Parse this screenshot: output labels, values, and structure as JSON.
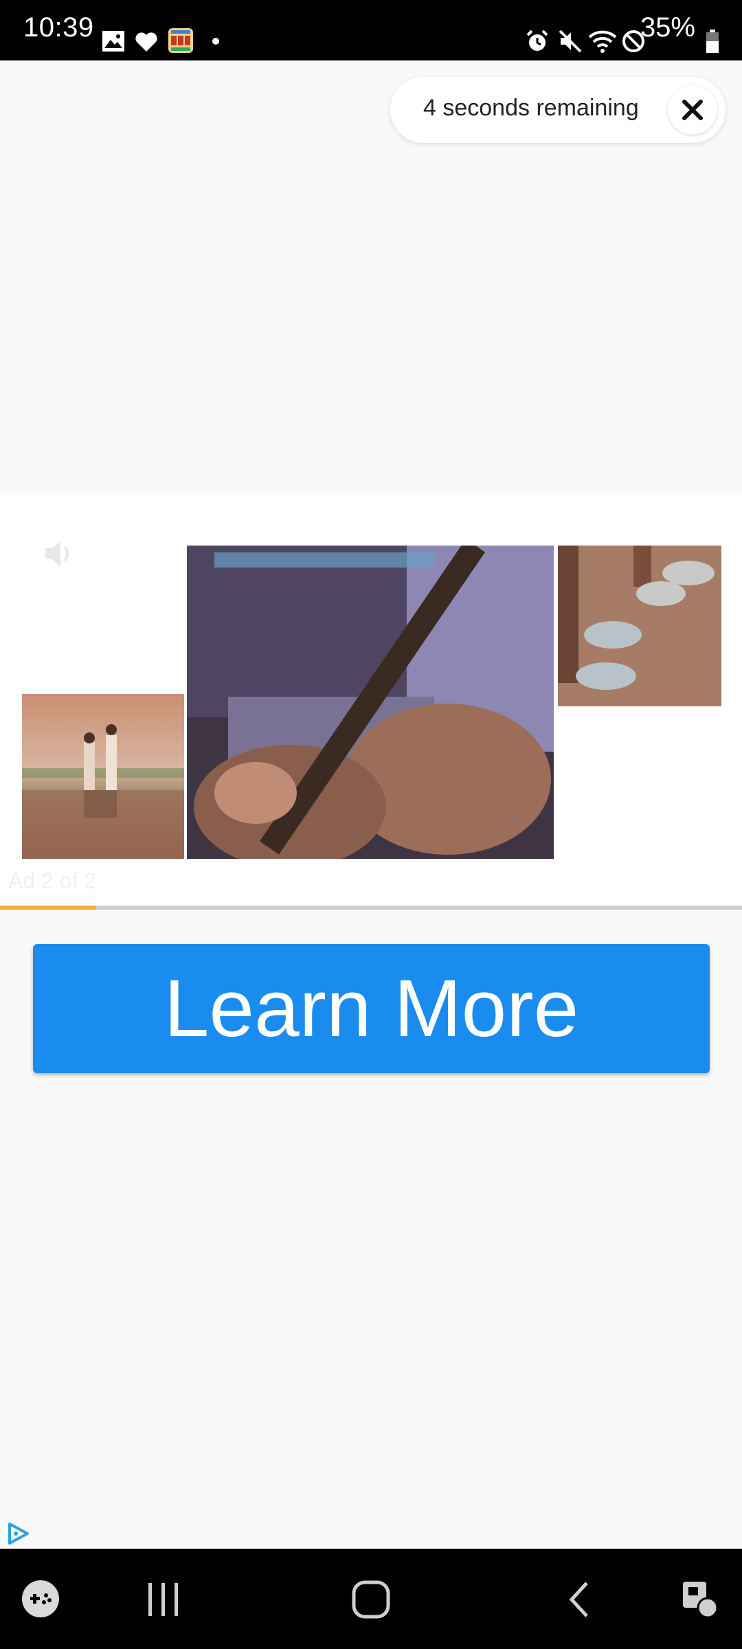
{
  "status_bar": {
    "time": "10:39",
    "battery": "35%",
    "left_icons": [
      "gallery-icon",
      "heart-icon",
      "slots-app-icon",
      "dot-icon"
    ],
    "right_icons": [
      "alarm-icon",
      "mute-icon",
      "wifi-icon",
      "do-not-disturb-icon",
      "battery-icon"
    ]
  },
  "countdown": {
    "text": "4 seconds remaining",
    "close_icon": "close-icon"
  },
  "ad": {
    "counter_text": "Ad 2 of 2",
    "progress": 0.13,
    "progress_color": "#f2b233",
    "sound_icon": "speaker-icon",
    "images": [
      "couple-standing-photo",
      "person-holding-paddle-photo",
      "feet-in-sandals-photo"
    ]
  },
  "cta": {
    "label": "Learn More",
    "color": "#1a8cef"
  },
  "adchoices_icon": "adchoices-icon",
  "nav_bar": {
    "icons": [
      "game-launcher-icon",
      "recent-apps-icon",
      "home-icon",
      "back-icon",
      "assistant-icon"
    ]
  }
}
